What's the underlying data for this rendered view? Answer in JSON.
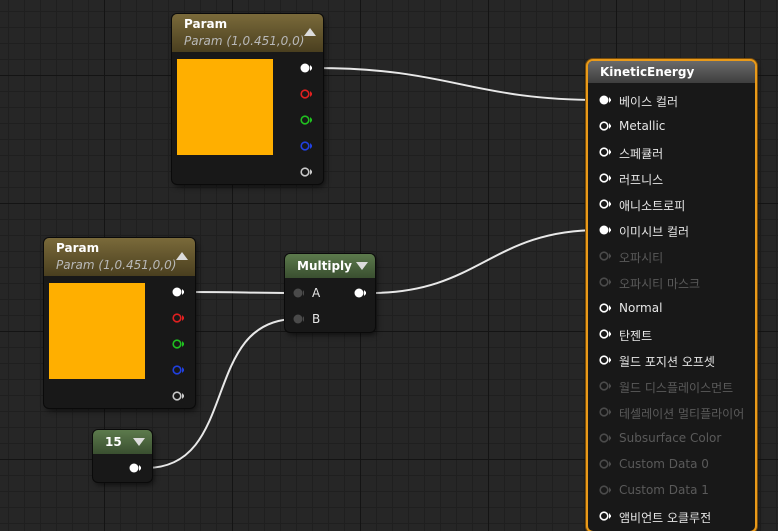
{
  "param_node_1": {
    "title": "Param",
    "subtitle": "Param (1,0.451,0,0)",
    "color": "#ffaf00"
  },
  "param_node_2": {
    "title": "Param",
    "subtitle": "Param (1,0.451,0,0)",
    "color": "#ffaf00"
  },
  "multiply_node": {
    "title": "Multiply",
    "input_a": "A",
    "input_b": "B"
  },
  "constant_node": {
    "value": "15"
  },
  "kinetic_node": {
    "title": "KineticEnergy",
    "inputs": [
      {
        "label": "베이스 컬러",
        "enabled": true,
        "connected": true
      },
      {
        "label": "Metallic",
        "enabled": true,
        "connected": false
      },
      {
        "label": "스페큘러",
        "enabled": true,
        "connected": false
      },
      {
        "label": "러프니스",
        "enabled": true,
        "connected": false
      },
      {
        "label": "애니소트로피",
        "enabled": true,
        "connected": false
      },
      {
        "label": "이미시브 컬러",
        "enabled": true,
        "connected": true
      },
      {
        "label": "오파시티",
        "enabled": false,
        "connected": false
      },
      {
        "label": "오파시티 마스크",
        "enabled": false,
        "connected": false
      },
      {
        "label": "Normal",
        "enabled": true,
        "connected": false
      },
      {
        "label": "탄젠트",
        "enabled": true,
        "connected": false
      },
      {
        "label": "월드 포지션 오프셋",
        "enabled": true,
        "connected": false
      },
      {
        "label": "월드 디스플레이스먼트",
        "enabled": false,
        "connected": false
      },
      {
        "label": "테셀레이션 멀티플라이어",
        "enabled": false,
        "connected": false
      },
      {
        "label": "Subsurface Color",
        "enabled": false,
        "connected": false
      },
      {
        "label": "Custom Data 0",
        "enabled": false,
        "connected": false
      },
      {
        "label": "Custom Data 1",
        "enabled": false,
        "connected": false
      },
      {
        "label": "앰비언트 오클루전",
        "enabled": true,
        "connected": false
      }
    ]
  },
  "pin_colors": {
    "rgba": "#ffffff",
    "r": "#e02020",
    "g": "#20c020",
    "b": "#2040e0",
    "a": "#c8c8c8",
    "disabled": "#4a4a4a"
  },
  "wire_color": "#e8e8e8",
  "frame_color": "#e99a1a"
}
